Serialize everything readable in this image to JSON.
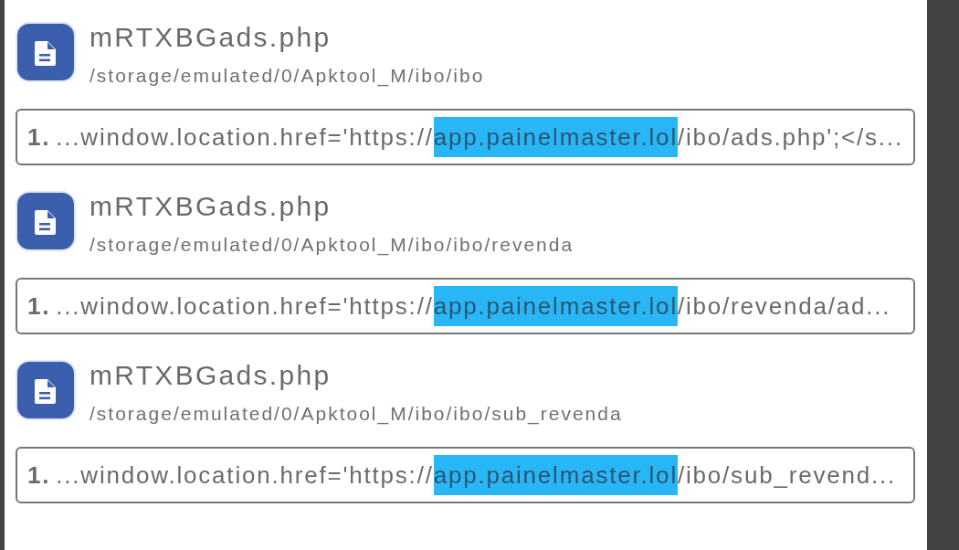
{
  "results": [
    {
      "file_name": "mRTXBGads.php",
      "path": "/storage/emulated/0/Apktool_M/ibo/ibo",
      "matches": [
        {
          "number": "1.",
          "before": "...window.location.href='https://",
          "highlight": "app.painelmaster.lol",
          "after": "/ibo/ads.php';</s..."
        }
      ]
    },
    {
      "file_name": "mRTXBGads.php",
      "path": "/storage/emulated/0/Apktool_M/ibo/ibo/revenda",
      "matches": [
        {
          "number": "1.",
          "before": "...window.location.href='https://",
          "highlight": "app.painelmaster.lol",
          "after": "/ibo/revenda/ad..."
        }
      ]
    },
    {
      "file_name": "mRTXBGads.php",
      "path": "/storage/emulated/0/Apktool_M/ibo/ibo/sub_revenda",
      "matches": [
        {
          "number": "1.",
          "before": "...window.location.href='https://",
          "highlight": "app.painelmaster.lol",
          "after": "/ibo/sub_revend..."
        }
      ]
    }
  ]
}
